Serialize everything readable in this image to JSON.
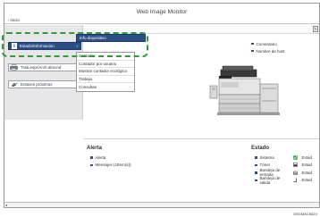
{
  "window": {
    "title": "Web Image Monitor"
  },
  "nav": {
    "home_label": "Inicio"
  },
  "sidebar": {
    "items": [
      {
        "label": "Estado/Información",
        "icon": "info-icon"
      },
      {
        "label": "Trab.espr/Arch.almcnd",
        "icon": "printer-icon"
      },
      {
        "label": "Enlaces próximos",
        "icon": "link-icon"
      }
    ]
  },
  "submenu_header": {
    "label": "Info.dispositivo"
  },
  "submenu": {
    "items": [
      {
        "label": "Contador"
      },
      {
        "label": "Contador por usuario"
      },
      {
        "label": "Mostrar contador ecológico"
      },
      {
        "label": "Trabajo"
      },
      {
        "label": "Consultas"
      }
    ]
  },
  "device_info": {
    "comment_label": "Comentario",
    "host_label": "Nombre de host"
  },
  "alerta": {
    "title": "Alerta",
    "items": [
      {
        "label": "Alerta"
      },
      {
        "label": "Mensajes (1Item(s))"
      }
    ]
  },
  "estado": {
    "title": "Estado",
    "items": [
      {
        "label": "Sistema",
        "icon": "status-ok-icon",
        "value": "Estad"
      },
      {
        "label": "Tóner",
        "icon": "toner-icon",
        "value": "Estad"
      },
      {
        "label": "Bandeja de entrada",
        "icon": "input-tray-icon",
        "value": "Estad"
      },
      {
        "label": "Bandeja de salida",
        "icon": "output-tray-icon",
        "value": "Estad"
      }
    ]
  },
  "footer": {
    "doc_code": "DSCMAC652V"
  },
  "colors": {
    "accent": "#2c4e86",
    "highlight_ring": "#2f9a3a",
    "status_ok": "#2f9a3a"
  }
}
